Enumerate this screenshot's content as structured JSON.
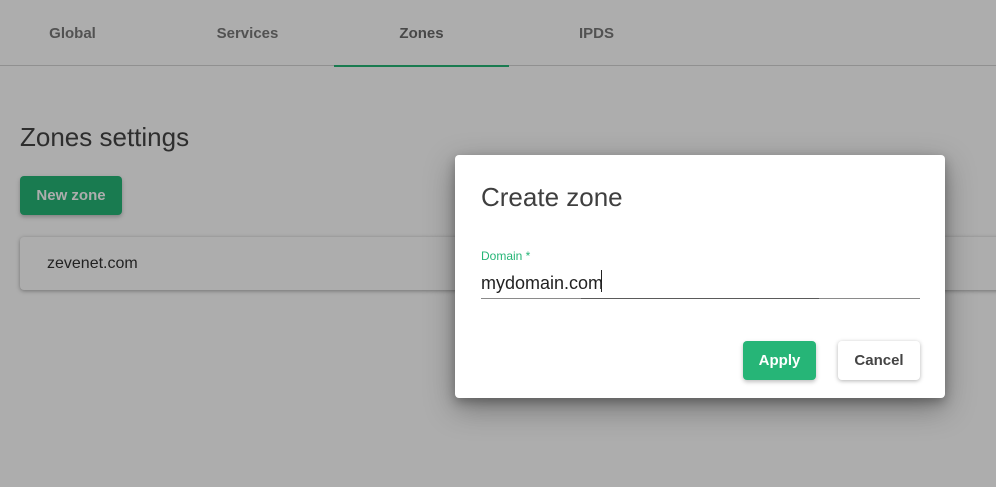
{
  "tabs": [
    {
      "label": "Global",
      "active": false
    },
    {
      "label": "Services",
      "active": false
    },
    {
      "label": "Zones",
      "active": true
    },
    {
      "label": "IPDS",
      "active": false
    }
  ],
  "main": {
    "title": "Zones settings",
    "new_zone_label": "New zone",
    "zones": [
      "zevenet.com"
    ]
  },
  "dialog": {
    "title": "Create zone",
    "domain_label": "Domain *",
    "domain_value": "mydomain.com",
    "apply_label": "Apply",
    "cancel_label": "Cancel"
  },
  "colors": {
    "accent": "#26b577",
    "overlay": "rgba(0,0,0,0.32)"
  }
}
